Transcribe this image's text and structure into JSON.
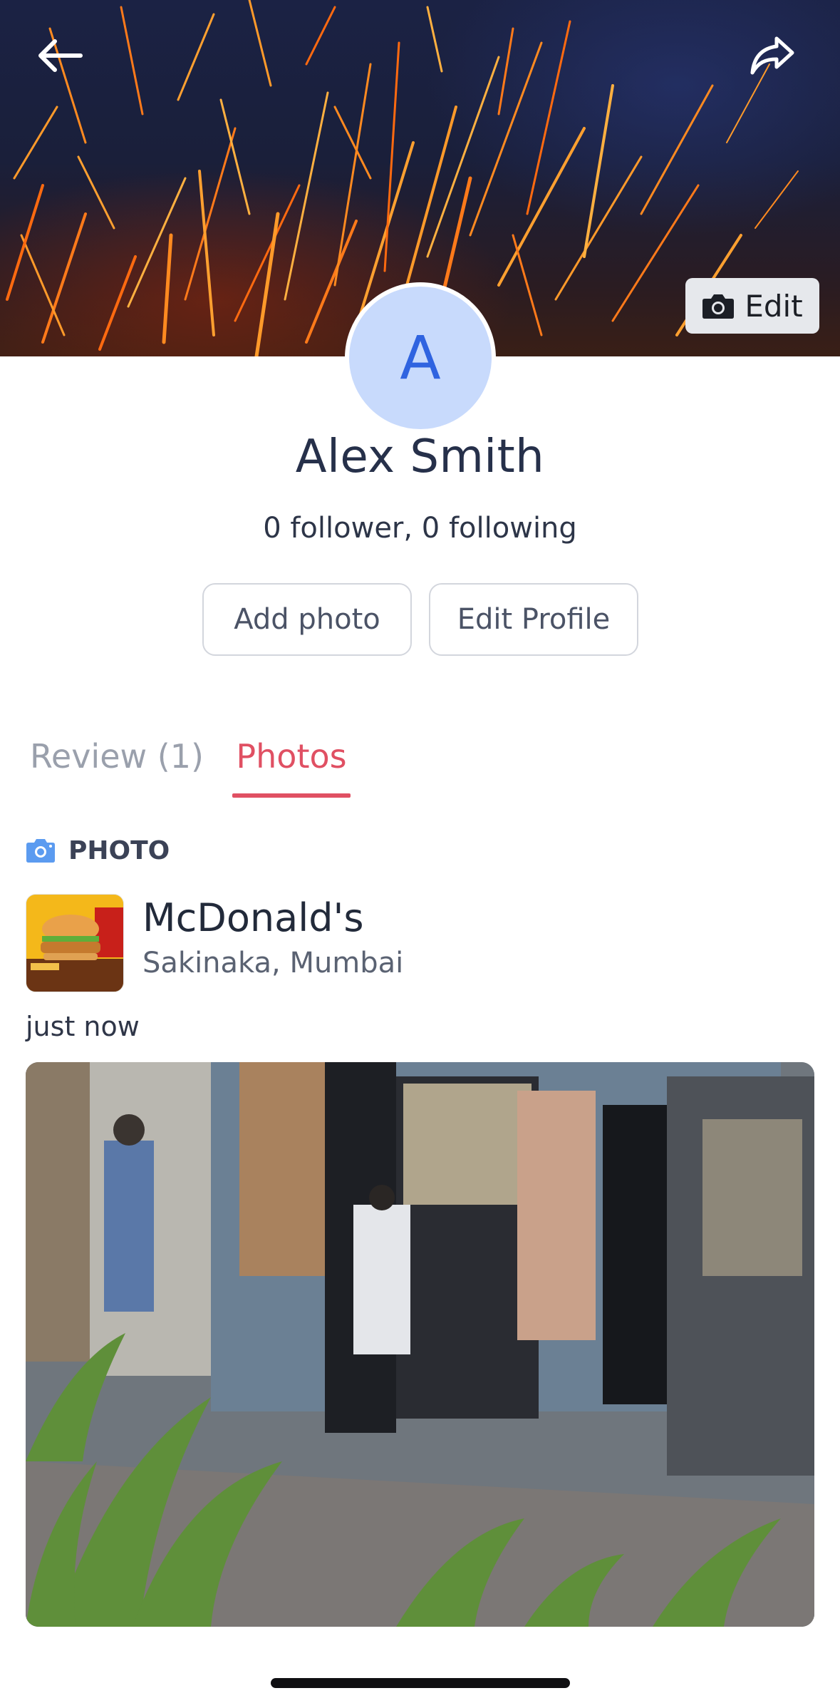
{
  "header": {
    "back_icon": "arrow-left-icon",
    "share_icon": "share-icon",
    "edit_cover_label": "Edit",
    "edit_cover_icon": "camera-icon"
  },
  "profile": {
    "avatar_initial": "A",
    "avatar_color": "#c8dafc",
    "avatar_text_color": "#2f63e0",
    "name": "Alex Smith",
    "follow_stats": "0 follower, 0 following"
  },
  "actions": {
    "add_photo_label": "Add photo",
    "edit_profile_label": "Edit Profile"
  },
  "tabs": [
    {
      "label": "Review (1)",
      "active": false
    },
    {
      "label": "Photos",
      "active": true
    }
  ],
  "accent_color": "#e05063",
  "feed": {
    "section_icon": "camera-icon",
    "section_label": "PHOTO",
    "restaurant": {
      "name": "McDonald's",
      "location": "Sakinaka, Mumbai"
    },
    "timestamp": "just now"
  }
}
